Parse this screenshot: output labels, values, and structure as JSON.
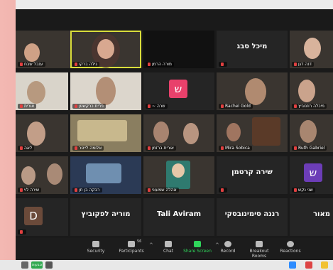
{
  "tiles": [
    {
      "id": "t1",
      "name": "ענבל שבח",
      "type": "video",
      "colors": [
        "#5b4a3f",
        "#c9a38a"
      ]
    },
    {
      "id": "t2",
      "name": "גילה ברקו",
      "type": "video",
      "pinned": true,
      "colors": [
        "#c8b7a6",
        "#7a5a4a"
      ]
    },
    {
      "id": "t3",
      "name": "מורה הרמן",
      "type": "dark"
    },
    {
      "id": "t4",
      "big": "מיכל סבג",
      "type": "name"
    },
    {
      "id": "t5",
      "name": "דנה דגן",
      "type": "video",
      "colors": [
        "#6b5d55",
        "#d6b7a0"
      ]
    },
    {
      "id": "t6",
      "name": "אורית",
      "type": "video",
      "colors": [
        "#d8d2c8",
        "#b8a28f"
      ]
    },
    {
      "id": "t7",
      "name": "נירית כרקשטן",
      "type": "video",
      "colors": [
        "#ddd7cd",
        "#b89a82"
      ]
    },
    {
      "id": "t8",
      "name": "~ שרה",
      "type": "avatar",
      "letter": "ש",
      "avatarColor": "#e8416b"
    },
    {
      "id": "t9",
      "name": "Rachel Gold",
      "type": "video",
      "colors": [
        "#3d3833",
        "#b88f73"
      ]
    },
    {
      "id": "t10",
      "name": "מיכלה רוזנוביץ",
      "type": "video",
      "colors": [
        "#8a7d70",
        "#c4a08a"
      ]
    },
    {
      "id": "t11",
      "name": "לאה",
      "type": "video",
      "colors": [
        "#6f6660",
        "#c8a894"
      ]
    },
    {
      "id": "t12",
      "name": "אלומה לייטר",
      "type": "video",
      "colors": [
        "#8b7e60",
        "#c9b98f"
      ]
    },
    {
      "id": "t13",
      "name": "אורית ברזמן",
      "type": "video",
      "colors": [
        "#40403e",
        "#b39380"
      ]
    },
    {
      "id": "t14",
      "name": "Mira Sobica",
      "type": "video",
      "colors": [
        "#3b3027",
        "#8c5b3d"
      ]
    },
    {
      "id": "t15",
      "name": "Ruth Gabriel",
      "type": "video",
      "colors": [
        "#4c4540",
        "#a88670"
      ]
    },
    {
      "id": "t16",
      "name": "שירה לוי",
      "type": "video",
      "colors": [
        "#6a5f57",
        "#b99a86"
      ]
    },
    {
      "id": "t17",
      "name": "רבקה בן חן",
      "type": "video",
      "colors": [
        "#2b3a55",
        "#6f8fb0"
      ]
    },
    {
      "id": "t18",
      "name": "אהלה שמעוני",
      "type": "video",
      "colors": [
        "#2f7a6f",
        "#e6c7a9"
      ]
    },
    {
      "id": "t19",
      "big": "שירה קרטמן",
      "type": "name"
    },
    {
      "id": "t20",
      "name": "שני נקש",
      "type": "avatar",
      "letter": "ש",
      "avatarColor": "#6c3db7"
    },
    {
      "id": "t21",
      "letter": "D",
      "type": "avatar",
      "avatarColor": "#6b4a3a"
    },
    {
      "id": "t22",
      "big": "מוריה לפקוביץ",
      "type": "name"
    },
    {
      "id": "t23",
      "big": "Tali Aviram",
      "type": "name"
    },
    {
      "id": "t24",
      "big": "רננה סימינובסקי",
      "type": "name"
    },
    {
      "id": "t25",
      "big": "מאור",
      "type": "name"
    }
  ],
  "toolbar": {
    "security": "Security",
    "participants": "Participants",
    "participants_count": "56",
    "chat": "Chat",
    "share": "Share Screen",
    "record": "Record",
    "breakout": "Breakout Rooms",
    "reactions": "Reactions"
  },
  "taskbar": {
    "badge": "טבעות"
  },
  "colors": {
    "share": "#2fd45a",
    "pinned": "#d9dd3b",
    "window": "#1a1a1a"
  }
}
